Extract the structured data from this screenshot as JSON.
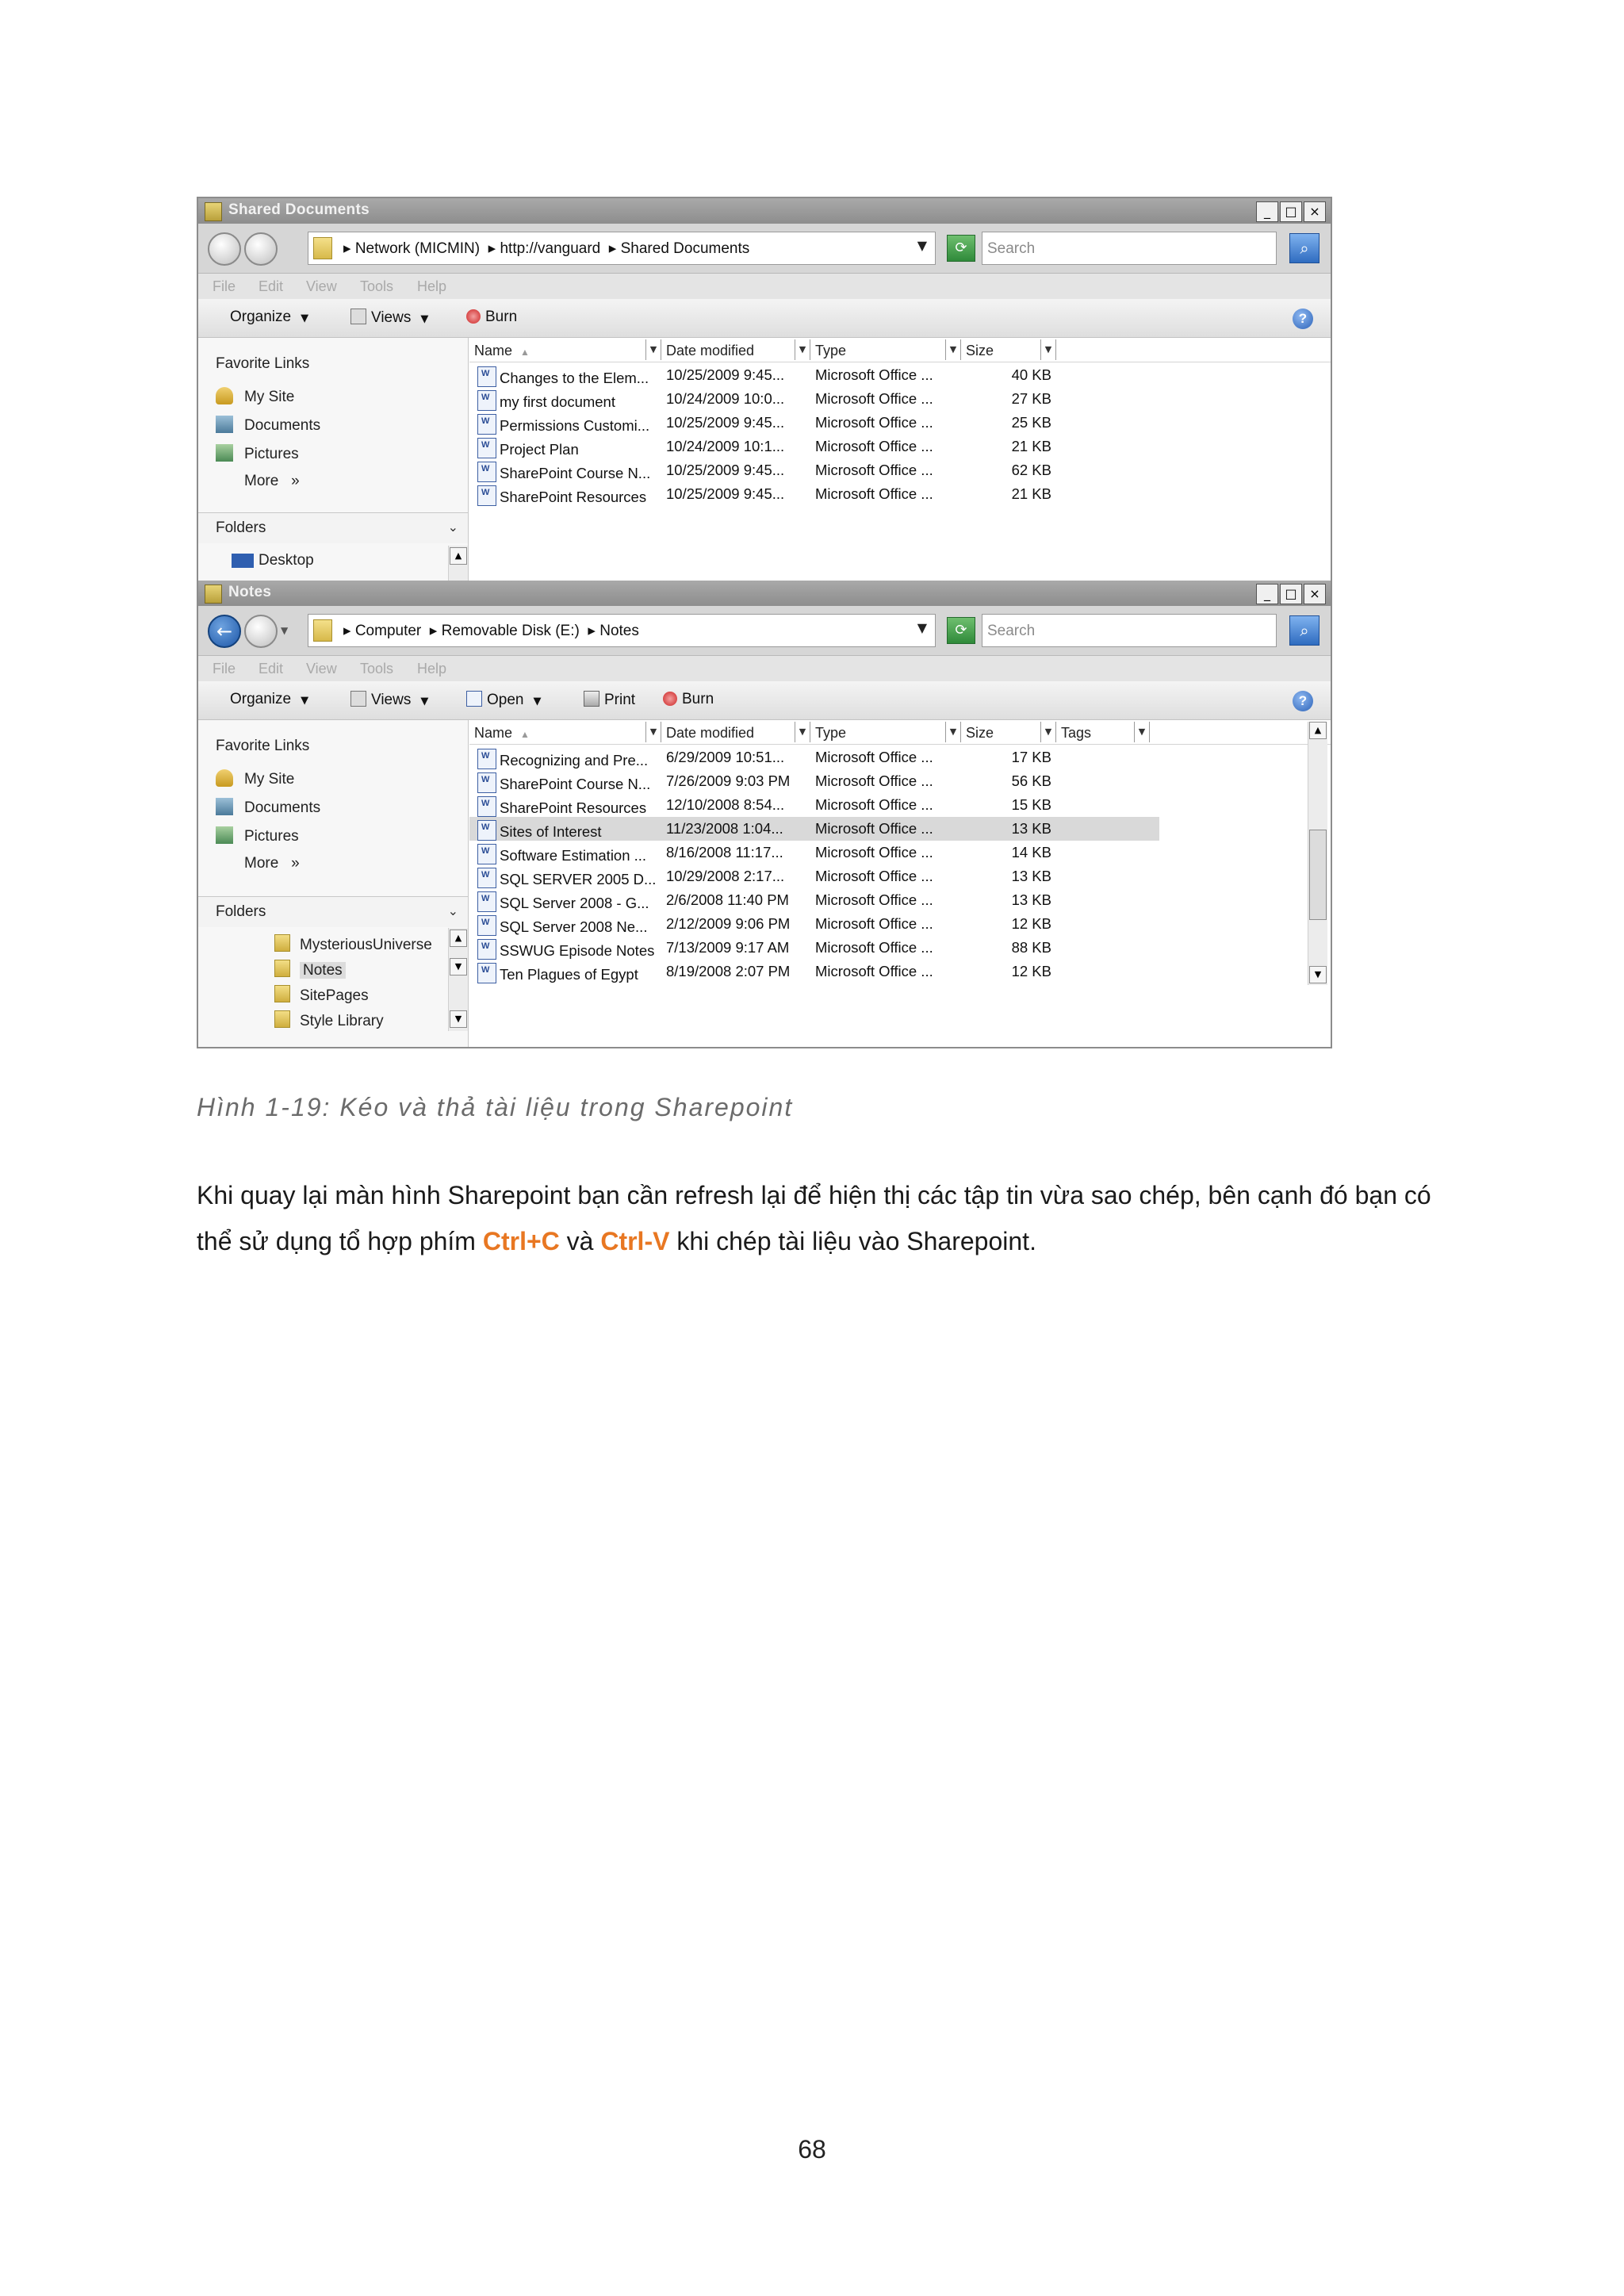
{
  "window1": {
    "title": "Shared Documents",
    "address": [
      "Network (MICMIN)",
      "http://vanguard",
      "Shared Documents"
    ],
    "search_placeholder": "Search",
    "menu": [
      "File",
      "Edit",
      "View",
      "Tools",
      "Help"
    ],
    "toolbar": {
      "organize": "Organize",
      "views": "Views",
      "burn": "Burn"
    },
    "nav": {
      "favorite_links": "Favorite Links",
      "links": [
        "My Site",
        "Documents",
        "Pictures",
        "More"
      ],
      "more_chevron": "»",
      "folders": "Folders",
      "tree": [
        "Desktop"
      ]
    },
    "columns": [
      "Name",
      "Date modified",
      "Type",
      "Size"
    ],
    "files": [
      {
        "name": "Changes to the Elem...",
        "date": "10/25/2009 9:45...",
        "type": "Microsoft Office ...",
        "size": "40 KB"
      },
      {
        "name": "my first document",
        "date": "10/24/2009 10:0...",
        "type": "Microsoft Office ...",
        "size": "27 KB"
      },
      {
        "name": "Permissions Customi...",
        "date": "10/25/2009 9:45...",
        "type": "Microsoft Office ...",
        "size": "25 KB"
      },
      {
        "name": "Project Plan",
        "date": "10/24/2009 10:1...",
        "type": "Microsoft Office ...",
        "size": "21 KB"
      },
      {
        "name": "SharePoint Course N...",
        "date": "10/25/2009 9:45...",
        "type": "Microsoft Office ...",
        "size": "62 KB"
      },
      {
        "name": "SharePoint Resources",
        "date": "10/25/2009 9:45...",
        "type": "Microsoft Office ...",
        "size": "21 KB"
      }
    ]
  },
  "window2": {
    "title": "Notes",
    "address": [
      "Computer",
      "Removable Disk (E:)",
      "Notes"
    ],
    "search_placeholder": "Search",
    "menu": [
      "File",
      "Edit",
      "View",
      "Tools",
      "Help"
    ],
    "toolbar": {
      "organize": "Organize",
      "views": "Views",
      "open": "Open",
      "print": "Print",
      "burn": "Burn"
    },
    "nav": {
      "favorite_links": "Favorite Links",
      "links": [
        "My Site",
        "Documents",
        "Pictures",
        "More"
      ],
      "more_chevron": "»",
      "folders": "Folders",
      "tree": [
        "MysteriousUniverse",
        "Notes",
        "SitePages",
        "Style Library"
      ]
    },
    "columns": [
      "Name",
      "Date modified",
      "Type",
      "Size",
      "Tags"
    ],
    "files": [
      {
        "name": "Recognizing and Pre...",
        "date": "6/29/2009 10:51...",
        "type": "Microsoft Office ...",
        "size": "17 KB"
      },
      {
        "name": "SharePoint Course N...",
        "date": "7/26/2009 9:03 PM",
        "type": "Microsoft Office ...",
        "size": "56 KB"
      },
      {
        "name": "SharePoint Resources",
        "date": "12/10/2008 8:54...",
        "type": "Microsoft Office ...",
        "size": "15 KB"
      },
      {
        "name": "Sites of Interest",
        "date": "11/23/2008 1:04...",
        "type": "Microsoft Office ...",
        "size": "13 KB",
        "selected": true
      },
      {
        "name": "Software Estimation ...",
        "date": "8/16/2008 11:17...",
        "type": "Microsoft Office ...",
        "size": "14 KB"
      },
      {
        "name": "SQL SERVER 2005 D...",
        "date": "10/29/2008 2:17...",
        "type": "Microsoft Office ...",
        "size": "13 KB"
      },
      {
        "name": "SQL Server 2008 - G...",
        "date": "2/6/2008 11:40 PM",
        "type": "Microsoft Office ...",
        "size": "13 KB"
      },
      {
        "name": "SQL Server 2008 Ne...",
        "date": "2/12/2009 9:06 PM",
        "type": "Microsoft Office ...",
        "size": "12 KB"
      },
      {
        "name": "SSWUG Episode Notes",
        "date": "7/13/2009 9:17 AM",
        "type": "Microsoft Office ...",
        "size": "88 KB"
      },
      {
        "name": "Ten Plagues of Egypt",
        "date": "8/19/2008 2:07 PM",
        "type": "Microsoft Office ...",
        "size": "12 KB"
      }
    ]
  },
  "caption": "Hình 1-19: Kéo và thả tài liệu trong Sharepoint",
  "paragraph": {
    "part1": "Khi quay lại màn hình Sharepoint bạn cần refresh lại để hiện thị các tập tin vừa sao chép, bên cạnh đó bạn có thể sử dụng tổ hợp phím ",
    "key1": "Ctrl+C",
    "part2": " và ",
    "key2": "Ctrl-V",
    "part3": " khi chép tài liệu vào Sharepoint."
  },
  "page_number": "68",
  "colors": {
    "highlight": "#e87722",
    "caption": "#6b6b6b"
  }
}
